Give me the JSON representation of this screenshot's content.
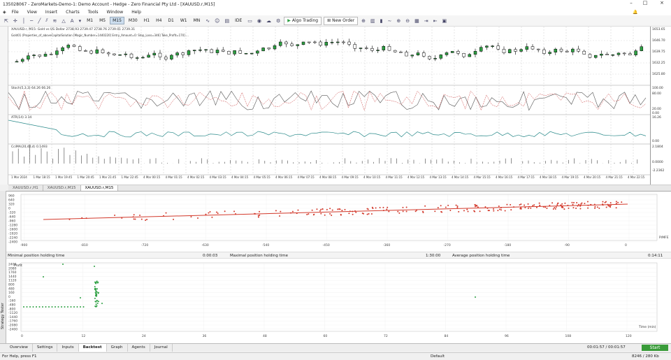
{
  "titlebar": {
    "title": "135028067 - ZeroMarkets-Demo-1: Demo Account - Hedge - Zero Financial Pty Ltd - [XAUUSD.r,M15]"
  },
  "menubar": {
    "items": [
      "File",
      "View",
      "Insert",
      "Charts",
      "Tools",
      "Window",
      "Help"
    ]
  },
  "toolbar": {
    "timeframes": [
      "M1",
      "M5",
      "M15",
      "M30",
      "H1",
      "H4",
      "D1",
      "W1",
      "MN"
    ],
    "active_timeframe": "M15",
    "ide_label": "IDE",
    "algo_label": "Algo Trading",
    "neworder_label": "New Order"
  },
  "chart": {
    "symbol_info": "XAUUSD.r, M15:  Gold vs US Dollar  2738.93 2739.47 2738.76 2739.01 2739.31",
    "ea_info": "Gold01 (Properties_of_aboveCapitalSolution [Magic_Number=1440220] Entry_Amount=0: Stop_Loss=346] Take_Profit=170] ...",
    "price_labels": [
      "1653.65",
      "1646.70",
      "1639.75",
      "1632.25",
      "1625.80"
    ],
    "stoch_label": "Stoch(5,3,3) 64.26 66.26",
    "stoch_scale": [
      "100.00",
      "80.00",
      "20.00",
      "0.00"
    ],
    "atr_label": "ATR(14) 3.14",
    "atr_scale": [
      "16.26",
      "0.00"
    ],
    "cci_label": "CciMA(20,40,4) 0.1493",
    "cci_scale": [
      "2.1804",
      "0.0000",
      "-2.2362"
    ],
    "time_labels": [
      "1 Mar 2024",
      "1 Mar 18:15",
      "1 Mar 19:45",
      "1 Mar 20:45",
      "1 Mar 21:45",
      "1 Mar 22:45",
      "4 Mar 00:15",
      "4 Mar 01:15",
      "4 Mar 02:15",
      "4 Mar 03:15",
      "4 Mar 04:15",
      "4 Mar 05:15",
      "4 Mar 06:15",
      "4 Mar 07:15",
      "4 Mar 08:15",
      "4 Mar 09:15",
      "4 Mar 10:15",
      "4 Mar 11:15",
      "4 Mar 12:15",
      "4 Mar 13:15",
      "4 Mar 14:15",
      "4 Mar 15:15",
      "4 Mar 16:15",
      "4 Mar 17:15",
      "4 Mar 18:15",
      "4 Mar 19:15",
      "4 Mar 20:15",
      "4 Mar 21:15",
      "4 Mar 22:15"
    ]
  },
  "chart_tabs": [
    "XAUUSD.r,H1",
    "XAUUSD.r,M15",
    "XAUUSD.r,M15"
  ],
  "mfe_chart": {
    "y_labels": [
      "960",
      "640",
      "320",
      "0",
      "-320",
      "-640",
      "-960",
      "-1280",
      "-1600",
      "-1920",
      "-2240",
      "-2400"
    ],
    "x_labels": [
      "-900",
      "-810",
      "-720",
      "-630",
      "-540",
      "-450",
      "-360",
      "-270",
      "-180",
      "-90",
      "0"
    ],
    "axis_name": "P/MFE"
  },
  "holding": {
    "min_label": "Minimal position holding time",
    "min_value": "0:00:03",
    "max_label": "Maximal position holding time",
    "max_value": "1:30:00",
    "avg_label": "Average position holding time",
    "avg_value": "0:14:11"
  },
  "time_chart": {
    "profit_label": "Profit",
    "y_labels": [
      "2400",
      "2080",
      "1760",
      "1440",
      "1120",
      "800",
      "480",
      "160",
      "0",
      "-160",
      "-480",
      "-800",
      "-1120",
      "-1440",
      "-1760",
      "-2080",
      "-2400"
    ],
    "x_labels": [
      "0",
      "12",
      "24",
      "36",
      "48",
      "60",
      "72",
      "84",
      "96",
      "108",
      "120"
    ],
    "x_axis_name": "Time (min)"
  },
  "tester_label": "Strategy Tester",
  "bottom_tabs": [
    "Overview",
    "Settings",
    "Inputs",
    "Backtest",
    "Graph",
    "Agents",
    "Journal"
  ],
  "active_bottom_tab": "Backtest",
  "progress": {
    "elapsed": "00:01:57 / 00:01:57",
    "start_label": "Start"
  },
  "status": {
    "help": "For Help, press F1",
    "profile": "Default",
    "traffic": "8246 / 280 Kb"
  },
  "colors": {
    "red_series": "#d33a2c",
    "green_series": "#2ea043",
    "up_candle": "#2ea043",
    "down_candle": "#ffffff"
  }
}
